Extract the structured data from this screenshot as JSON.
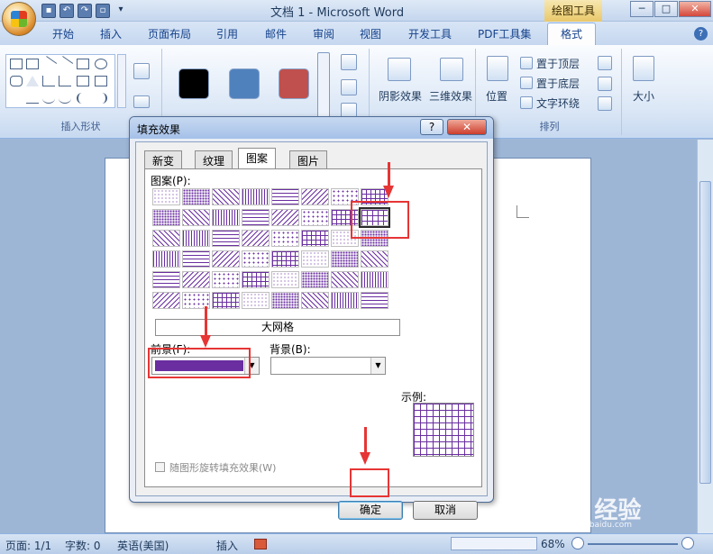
{
  "window": {
    "title": "文档 1 - Microsoft Word",
    "context_tab": "绘图工具",
    "buttons": [
      "─",
      "□",
      "✕"
    ]
  },
  "ribbon_tabs": [
    "开始",
    "插入",
    "页面布局",
    "引用",
    "邮件",
    "审阅",
    "视图",
    "开发工具",
    "PDF工具集",
    "格式"
  ],
  "ribbon": {
    "insert_shapes_label": "插入形状",
    "shadow_effect": "阴影效果",
    "three_d_effect": "三维效果",
    "position": "位置",
    "bring_front": "置于顶层",
    "send_back": "置于底层",
    "text_wrap": "文字环绕",
    "arrange_label": "排列",
    "size": "大小",
    "help": "?"
  },
  "dialog": {
    "title": "填充效果",
    "help": "?",
    "close": "✕",
    "tabs": [
      "新变",
      "纹理",
      "图案",
      "图片"
    ],
    "active_tab": "图案",
    "pattern_label": "图案(P):",
    "pattern_name": "大网格",
    "foreground_label": "前景(F):",
    "background_label": "背景(B):",
    "sample_label": "示例:",
    "rotate_checkbox": "随图形旋转填充效果(W)",
    "ok": "确定",
    "cancel": "取消",
    "foreground_color": "#6a2ea0"
  },
  "statusbar": {
    "page": "页面: 1/1",
    "words": "字数: 0",
    "language": "英语(美国)",
    "mode": "插入",
    "zoom": "68%"
  },
  "watermark": {
    "text": "Bai 经验",
    "url": "jingyan.baidu.com"
  }
}
